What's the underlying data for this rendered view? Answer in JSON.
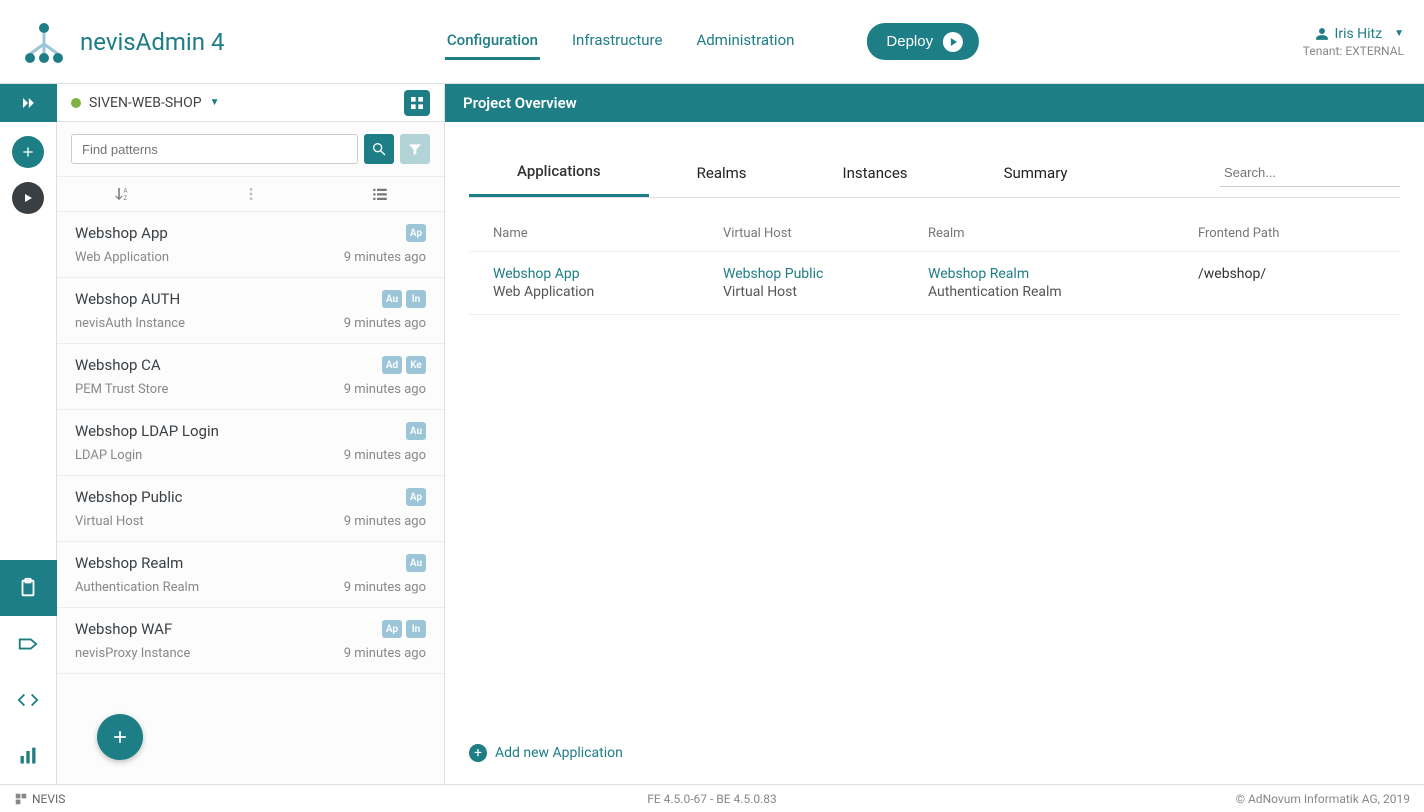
{
  "header": {
    "brand": "nevisAdmin 4",
    "nav": [
      "Configuration",
      "Infrastructure",
      "Administration"
    ],
    "active_nav": "Configuration",
    "deploy_label": "Deploy",
    "user_name": "Iris Hitz",
    "tenant_label": "Tenant: EXTERNAL"
  },
  "sidebar": {
    "project_name": "SIVEN-WEB-SHOP",
    "search_placeholder": "Find patterns",
    "patterns": [
      {
        "name": "Webshop App",
        "type": "Web Application",
        "time": "9 minutes ago",
        "badges": [
          "Ap"
        ]
      },
      {
        "name": "Webshop AUTH",
        "type": "nevisAuth Instance",
        "time": "9 minutes ago",
        "badges": [
          "Au",
          "In"
        ]
      },
      {
        "name": "Webshop CA",
        "type": "PEM Trust Store",
        "time": "9 minutes ago",
        "badges": [
          "Ad",
          "Ke"
        ]
      },
      {
        "name": "Webshop LDAP Login",
        "type": "LDAP Login",
        "time": "9 minutes ago",
        "badges": [
          "Au"
        ]
      },
      {
        "name": "Webshop Public",
        "type": "Virtual Host",
        "time": "9 minutes ago",
        "badges": [
          "Ap"
        ]
      },
      {
        "name": "Webshop Realm",
        "type": "Authentication Realm",
        "time": "9 minutes ago",
        "badges": [
          "Au"
        ]
      },
      {
        "name": "Webshop WAF",
        "type": "nevisProxy Instance",
        "time": "9 minutes ago",
        "badges": [
          "Ap",
          "In"
        ]
      }
    ]
  },
  "main": {
    "title": "Project Overview",
    "tabs": [
      "Applications",
      "Realms",
      "Instances",
      "Summary"
    ],
    "active_tab": "Applications",
    "search_placeholder": "Search...",
    "columns": [
      "Name",
      "Virtual Host",
      "Realm",
      "Frontend Path"
    ],
    "rows": [
      {
        "name": "Webshop App",
        "name_sub": "Web Application",
        "vhost": "Webshop Public",
        "vhost_sub": "Virtual Host",
        "realm": "Webshop Realm",
        "realm_sub": "Authentication Realm",
        "path": "/webshop/"
      }
    ],
    "add_label": "Add new Application"
  },
  "footer": {
    "brand": "NEVIS",
    "version": "FE 4.5.0-67 - BE 4.5.0.83",
    "copyright": "© AdNovum Informatik AG, 2019"
  }
}
